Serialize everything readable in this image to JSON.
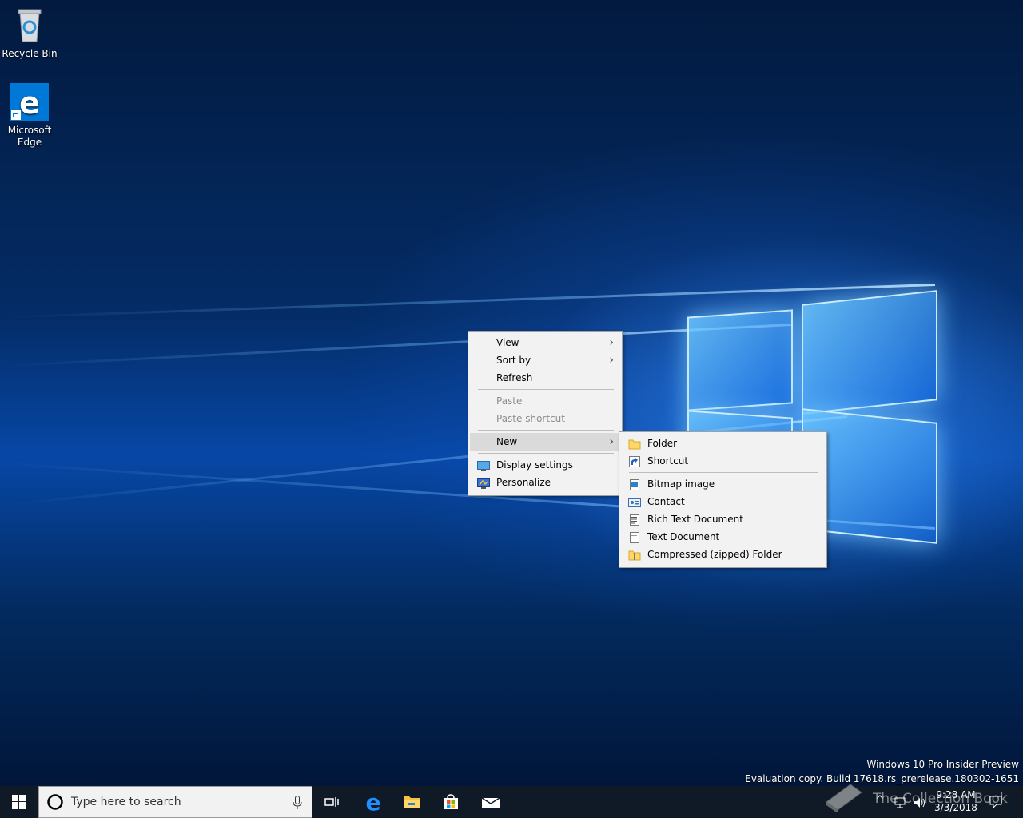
{
  "desktop_icons": [
    {
      "label": "Recycle Bin"
    },
    {
      "label": "Microsoft Edge"
    }
  ],
  "context_menu": {
    "items": [
      {
        "label": "View",
        "submenu": true
      },
      {
        "label": "Sort by",
        "submenu": true
      },
      {
        "label": "Refresh"
      },
      {
        "label": "Paste",
        "disabled": true
      },
      {
        "label": "Paste shortcut",
        "disabled": true
      },
      {
        "label": "New",
        "submenu": true,
        "highlighted": true
      },
      {
        "label": "Display settings",
        "icon": "display-settings-icon"
      },
      {
        "label": "Personalize",
        "icon": "personalize-icon"
      }
    ]
  },
  "new_submenu": {
    "items": [
      {
        "label": "Folder",
        "icon": "folder-icon"
      },
      {
        "label": "Shortcut",
        "icon": "shortcut-icon"
      },
      {
        "label": "Bitmap image",
        "icon": "bitmap-icon"
      },
      {
        "label": "Contact",
        "icon": "contact-icon"
      },
      {
        "label": "Rich Text Document",
        "icon": "rtf-document-icon"
      },
      {
        "label": "Text Document",
        "icon": "text-document-icon"
      },
      {
        "label": "Compressed (zipped) Folder",
        "icon": "zip-folder-icon"
      }
    ]
  },
  "watermark": {
    "line1": "Windows 10 Pro Insider Preview",
    "line2": "Evaluation copy. Build 17618.rs_prerelease.180302-1651"
  },
  "taskbar": {
    "search_placeholder": "Type here to search",
    "time": "9:28 AM",
    "date": "3/3/2018",
    "overlay_text": "The Collection Book"
  },
  "colors": {
    "taskbar": "#101a26",
    "menu_bg": "#f2f2f2",
    "accent": "#0078d7"
  }
}
